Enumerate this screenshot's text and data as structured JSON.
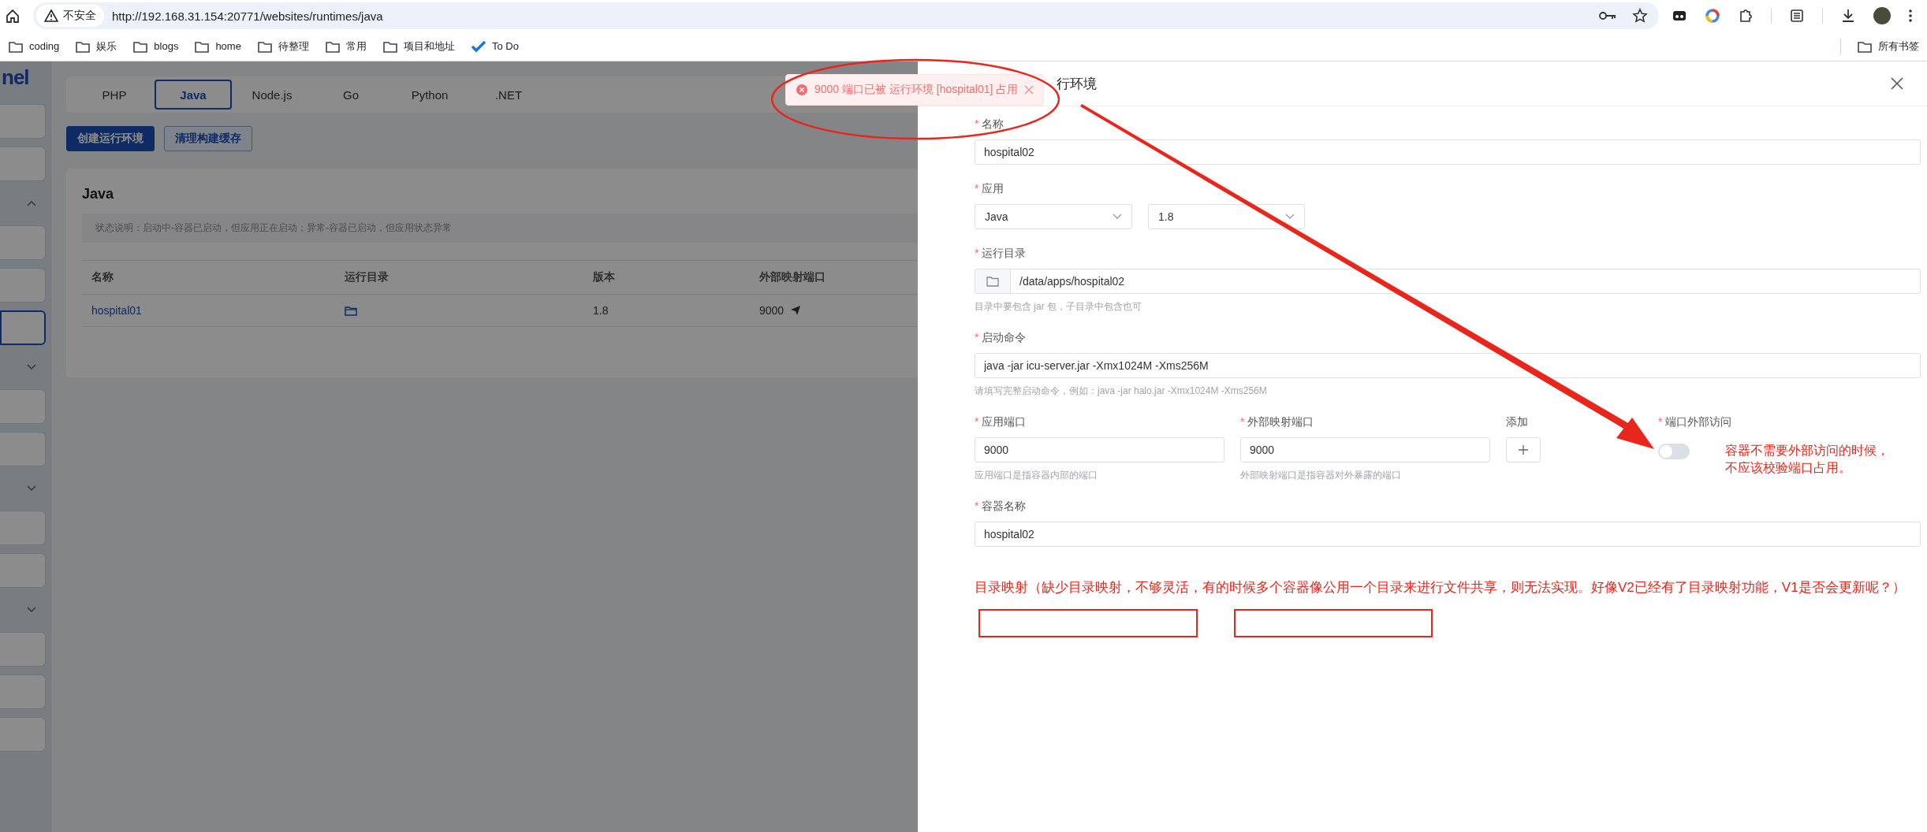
{
  "browser": {
    "security_label": "不安全",
    "url": "http://192.168.31.154:20771/websites/runtimes/java",
    "bookmarks": [
      {
        "label": "coding",
        "kind": "folder"
      },
      {
        "label": "娱乐",
        "kind": "folder"
      },
      {
        "label": "blogs",
        "kind": "folder"
      },
      {
        "label": "home",
        "kind": "folder"
      },
      {
        "label": "待整理",
        "kind": "folder"
      },
      {
        "label": "常用",
        "kind": "folder"
      },
      {
        "label": "项目和地址",
        "kind": "folder"
      },
      {
        "label": "To Do",
        "kind": "app"
      }
    ],
    "all_bookmarks": "所有书签"
  },
  "sidebar": {
    "logo": "nel",
    "items": [
      {
        "kind": "item",
        "selected": false
      },
      {
        "kind": "item",
        "selected": false
      },
      {
        "kind": "group",
        "expanded": true
      },
      {
        "kind": "item",
        "selected": false
      },
      {
        "kind": "item",
        "selected": false
      },
      {
        "kind": "item",
        "selected": true
      },
      {
        "kind": "group",
        "expanded": false
      },
      {
        "kind": "item",
        "selected": false
      },
      {
        "kind": "item",
        "selected": false
      },
      {
        "kind": "group",
        "expanded": false
      },
      {
        "kind": "item",
        "selected": false
      },
      {
        "kind": "item",
        "selected": false
      },
      {
        "kind": "group",
        "expanded": false
      },
      {
        "kind": "item",
        "selected": false
      },
      {
        "kind": "item",
        "selected": false
      },
      {
        "kind": "item",
        "selected": false
      }
    ]
  },
  "tabs": [
    {
      "label": "PHP",
      "selected": false
    },
    {
      "label": "Java",
      "selected": true
    },
    {
      "label": "Node.js",
      "selected": false
    },
    {
      "label": "Go",
      "selected": false
    },
    {
      "label": "Python",
      "selected": false
    },
    {
      "label": ".NET",
      "selected": false
    }
  ],
  "actions": [
    {
      "label": "创建运行环境",
      "primary": true
    },
    {
      "label": "清理构建缓存",
      "primary": false
    }
  ],
  "card": {
    "title": "Java",
    "note": "状态说明：启动中-容器已启动，但应用正在启动；异常-容器已启动，但应用状态异常",
    "table": {
      "columns": [
        "名称",
        "运行目录",
        "版本",
        "外部映射端口"
      ],
      "rows": [
        {
          "name": "hospital01",
          "version": "1.8",
          "port": "9000"
        }
      ]
    }
  },
  "toast": {
    "message": "9000 端口已被 运行环境 [hospital01] 占用"
  },
  "drawer": {
    "title": "行环境",
    "name": {
      "mark": "*",
      "label": "名称",
      "value": "hospital02"
    },
    "app": {
      "mark": "*",
      "label": "应用",
      "selects": [
        "Java",
        "1.8"
      ]
    },
    "dir": {
      "mark": "*",
      "label": "运行目录",
      "value": "/data/apps/hospital02",
      "help": "目录中要包含 jar 包，子目录中包含也可"
    },
    "command": {
      "mark": "*",
      "label": "启动命令",
      "value": "java -jar icu-server.jar -Xmx1024M -Xms256M",
      "help": "请填写完整启动命令，例如：java -jar halo.jar -Xmx1024M -Xms256M"
    },
    "ports": [
      {
        "mark": "*",
        "label": "应用端口",
        "value": "9000",
        "help": "应用端口是指容器内部的端口"
      },
      {
        "mark": "*",
        "label": "外部映射端口",
        "value": "9000",
        "help": "外部映射端口是指容器对外暴露的端口"
      }
    ],
    "add_label": "添加",
    "access": {
      "mark": "*",
      "label": "端口外部访问",
      "on": false
    },
    "container": {
      "mark": "*",
      "label": "容器名称",
      "value": "hospital02"
    }
  },
  "annotations": {
    "switch_note": [
      "容器不需要外部访问的时候，",
      "不应该校验端口占用。"
    ],
    "mapping_note": "目录映射（缺少目录映射，不够灵活，有的时候多个容器像公用一个目录来进行文件共享，则无法实现。好像V2已经有了目录映射功能，V1是否会更新呢？）"
  }
}
